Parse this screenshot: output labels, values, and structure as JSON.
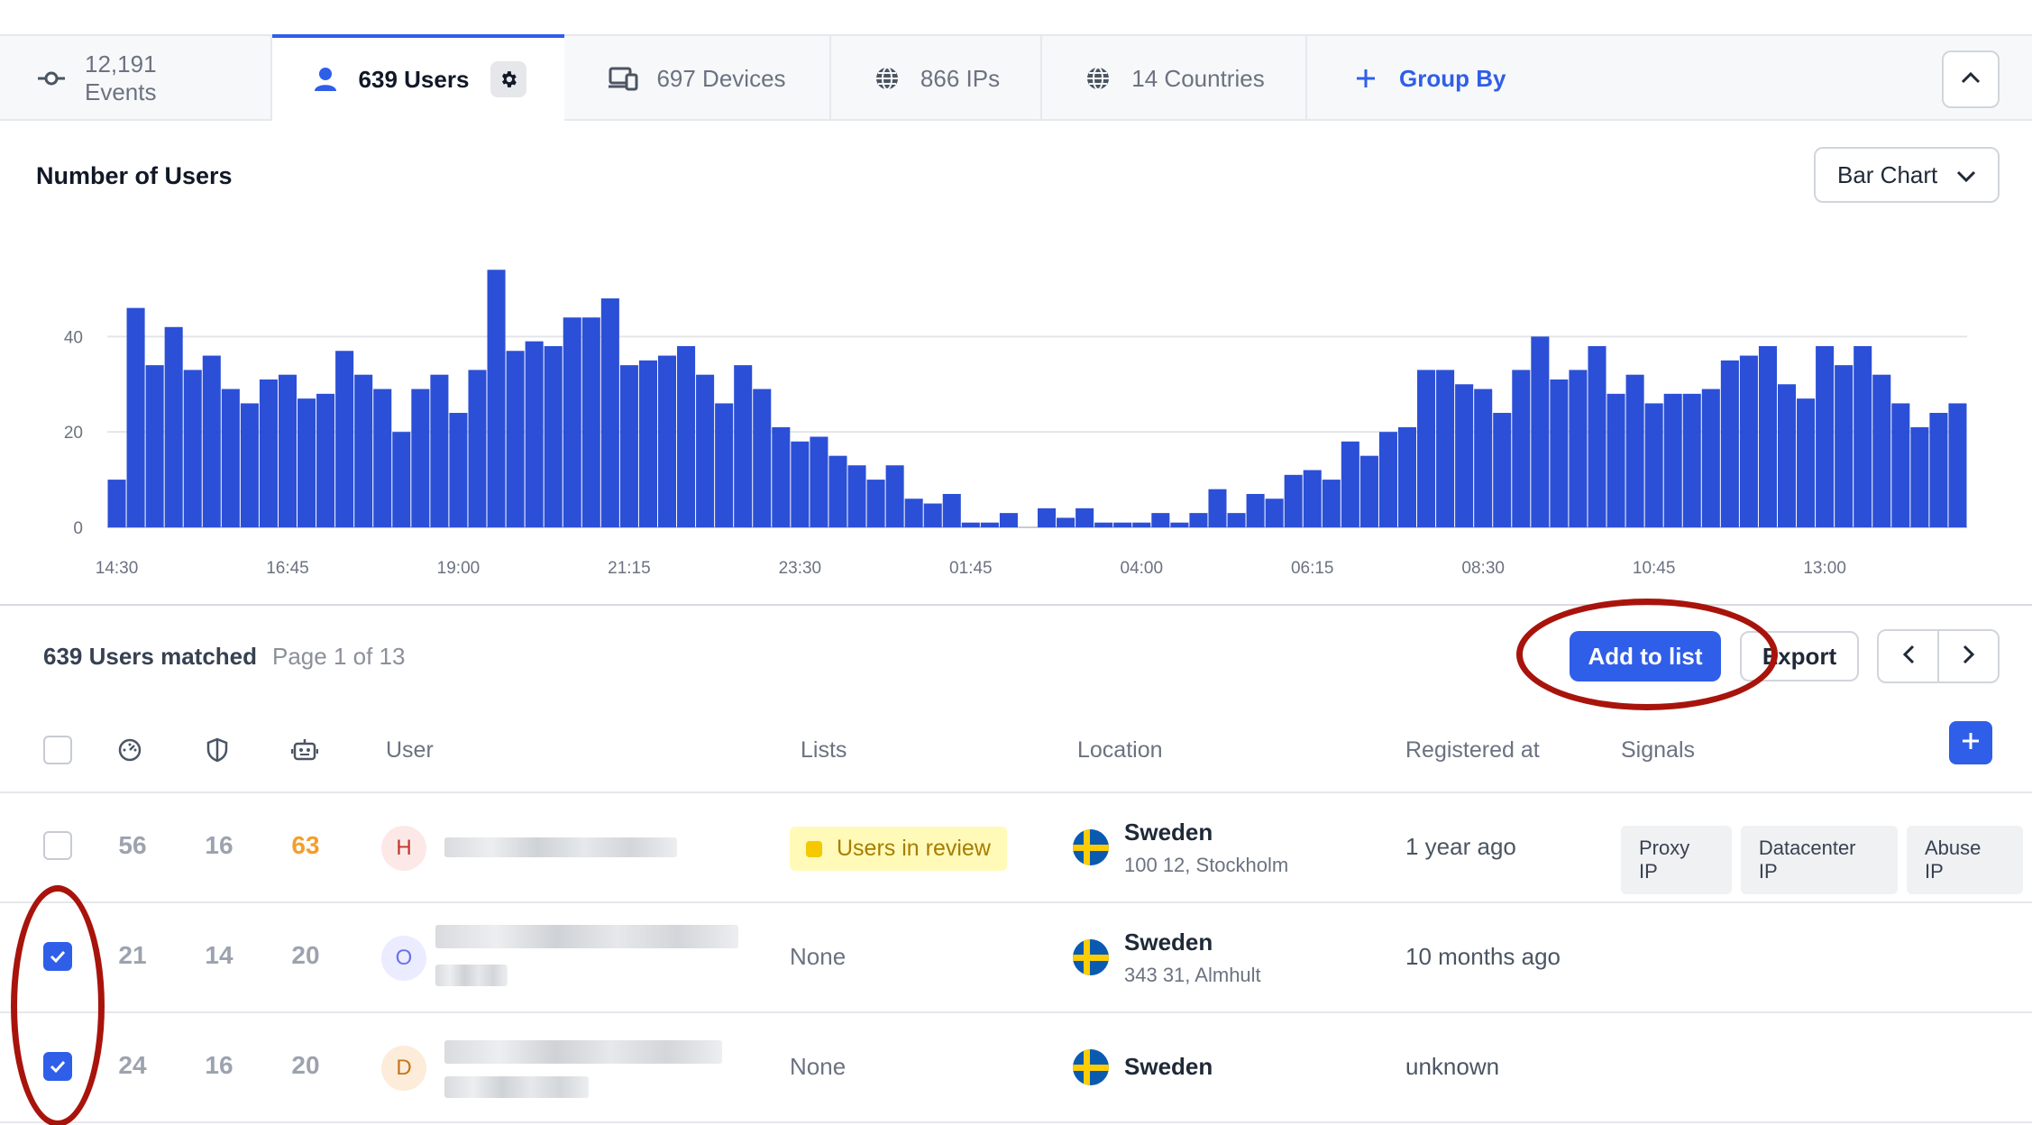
{
  "tabs": [
    {
      "label": "12,191 Events",
      "icon": "events-icon"
    },
    {
      "label": "639 Users",
      "icon": "user-icon",
      "active": true
    },
    {
      "label": "697 Devices",
      "icon": "devices-icon"
    },
    {
      "label": "866 IPs",
      "icon": "globe-icon"
    },
    {
      "label": "14 Countries",
      "icon": "globe-icon"
    },
    {
      "label": "Group By",
      "icon": "plus-icon"
    }
  ],
  "chart": {
    "title": "Number of Users",
    "type_selector": "Bar Chart"
  },
  "chart_data": {
    "type": "bar",
    "title": "Number of Users",
    "xlabel": "",
    "ylabel": "",
    "ylim": [
      0,
      55
    ],
    "yticks": [
      0,
      20,
      40
    ],
    "xtick_labels": [
      "14:30",
      "16:45",
      "19:00",
      "21:15",
      "23:30",
      "01:45",
      "04:00",
      "06:15",
      "08:30",
      "10:45",
      "13:00"
    ],
    "color": "#2b4fd6",
    "grid": true,
    "values": [
      10,
      46,
      34,
      42,
      33,
      36,
      29,
      26,
      31,
      32,
      27,
      28,
      37,
      32,
      29,
      20,
      29,
      32,
      24,
      33,
      54,
      37,
      39,
      38,
      44,
      44,
      48,
      34,
      35,
      36,
      38,
      32,
      26,
      34,
      29,
      21,
      18,
      19,
      15,
      13,
      10,
      13,
      6,
      5,
      7,
      1,
      1,
      3,
      0,
      4,
      2,
      4,
      1,
      1,
      1,
      3,
      1,
      3,
      8,
      3,
      7,
      6,
      11,
      12,
      10,
      18,
      15,
      20,
      21,
      33,
      33,
      30,
      29,
      24,
      33,
      40,
      31,
      33,
      38,
      28,
      32,
      26,
      28,
      28,
      29,
      35,
      36,
      38,
      30,
      27,
      38,
      34,
      38,
      32,
      26,
      21,
      24,
      26
    ]
  },
  "results": {
    "matched": "639 Users matched",
    "page": "Page 1 of 13",
    "add_to_list": "Add to list",
    "export": "Export"
  },
  "columns": {
    "user": "User",
    "lists": "Lists",
    "location": "Location",
    "registered": "Registered at",
    "signals": "Signals"
  },
  "rows": [
    {
      "checked": false,
      "s1": "56",
      "s2": "16",
      "s3": "63",
      "avatar": "H",
      "avatar_bg": "#fde8e8",
      "avatar_fg": "#c0392b",
      "list": "Users in review",
      "country": "Sweden",
      "city": "100 12, Stockholm",
      "registered": "1 year ago",
      "signals": [
        "Proxy IP",
        "Datacenter IP",
        "Abuse IP"
      ]
    },
    {
      "checked": true,
      "s1": "21",
      "s2": "14",
      "s3": "20",
      "avatar": "O",
      "avatar_bg": "#ebecff",
      "avatar_fg": "#6c72e8",
      "list": "None",
      "country": "Sweden",
      "city": "343 31, Almhult",
      "registered": "10 months ago",
      "signals": []
    },
    {
      "checked": true,
      "s1": "24",
      "s2": "16",
      "s3": "20",
      "avatar": "D",
      "avatar_bg": "#fdecd9",
      "avatar_fg": "#c77419",
      "list": "None",
      "country": "Sweden",
      "city": "",
      "registered": "unknown",
      "signals": []
    }
  ]
}
